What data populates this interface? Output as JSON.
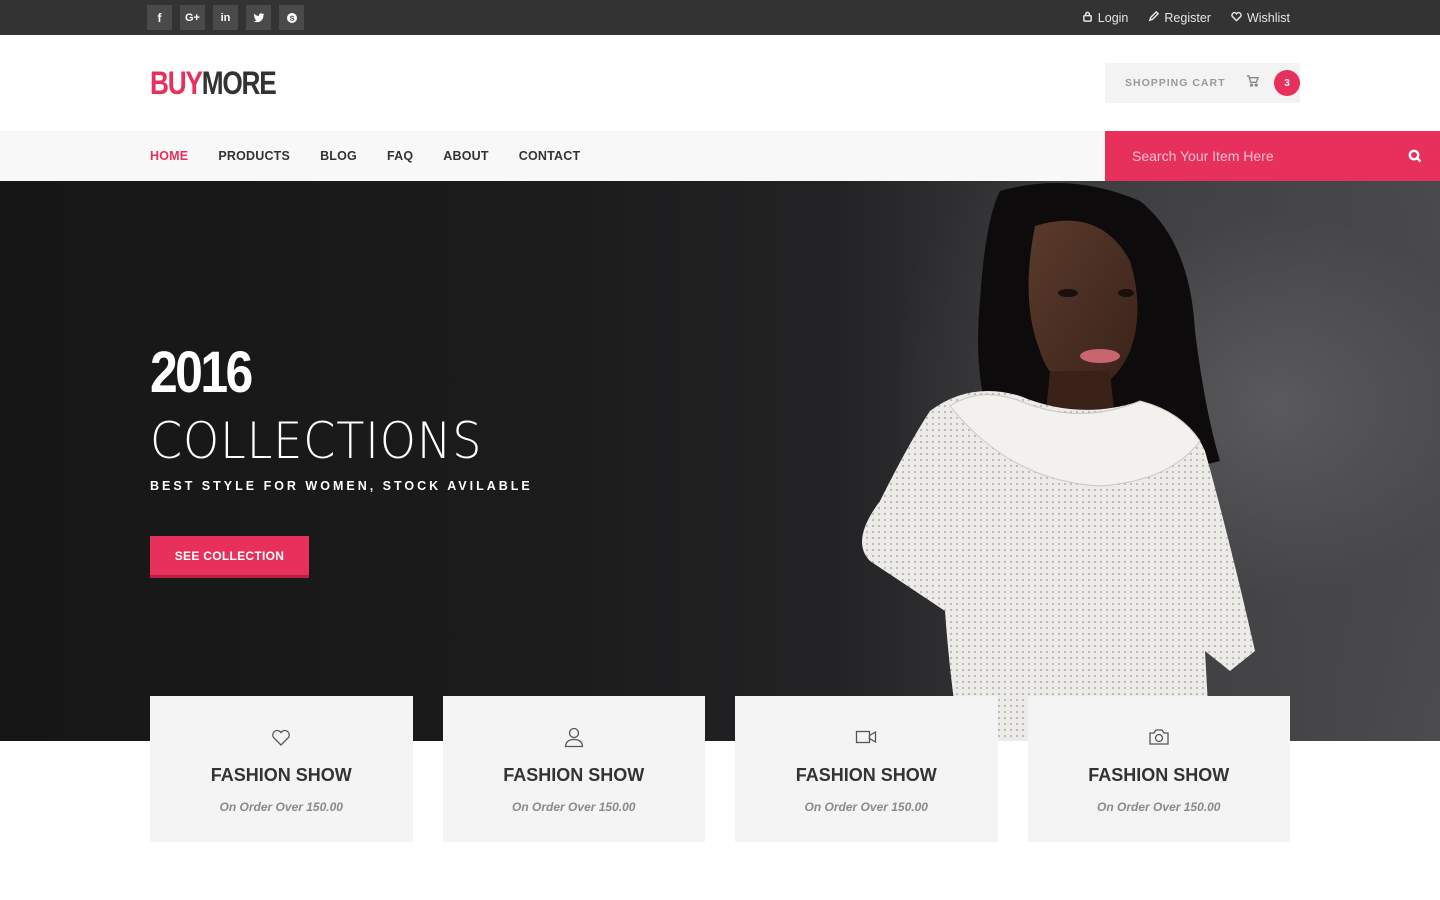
{
  "topbar": {
    "social": [
      {
        "icon": "facebook-icon",
        "glyph": "f"
      },
      {
        "icon": "google-plus-icon",
        "glyph": "G+"
      },
      {
        "icon": "linkedin-icon",
        "glyph": "in"
      },
      {
        "icon": "twitter-icon",
        "glyph": ""
      },
      {
        "icon": "skype-icon",
        "glyph": ""
      }
    ],
    "login": "Login",
    "register": "Register",
    "wishlist": "Wishlist"
  },
  "header": {
    "logo_part1": "BUY",
    "logo_part2": "MORE",
    "cart_label": "SHOPPING CART",
    "cart_count": "3"
  },
  "nav": {
    "items": [
      "HOME",
      "PRODUCTS",
      "BLOG",
      "FAQ",
      "ABOUT",
      "CONTACT"
    ],
    "active": "HOME",
    "search_placeholder": "Search Your Item Here"
  },
  "hero": {
    "year": "2016",
    "title": "COLLECTIONS",
    "tagline": "BEST STYLE FOR WOMEN, STOCK AVILABLE",
    "cta": "SEE COLLECTION"
  },
  "features": [
    {
      "icon": "heart-icon",
      "title": "FASHION SHOW",
      "subtitle": "On Order Over 150.00"
    },
    {
      "icon": "user-icon",
      "title": "FASHION SHOW",
      "subtitle": "On Order Over 150.00"
    },
    {
      "icon": "video-camera-icon",
      "title": "FASHION SHOW",
      "subtitle": "On Order Over 150.00"
    },
    {
      "icon": "camera-icon",
      "title": "FASHION SHOW",
      "subtitle": "On Order Over 150.00"
    }
  ],
  "colors": {
    "accent": "#e8305c",
    "topbar": "#333333",
    "nav_bg": "#f8f8f8",
    "feature_bg": "#f4f4f4"
  }
}
